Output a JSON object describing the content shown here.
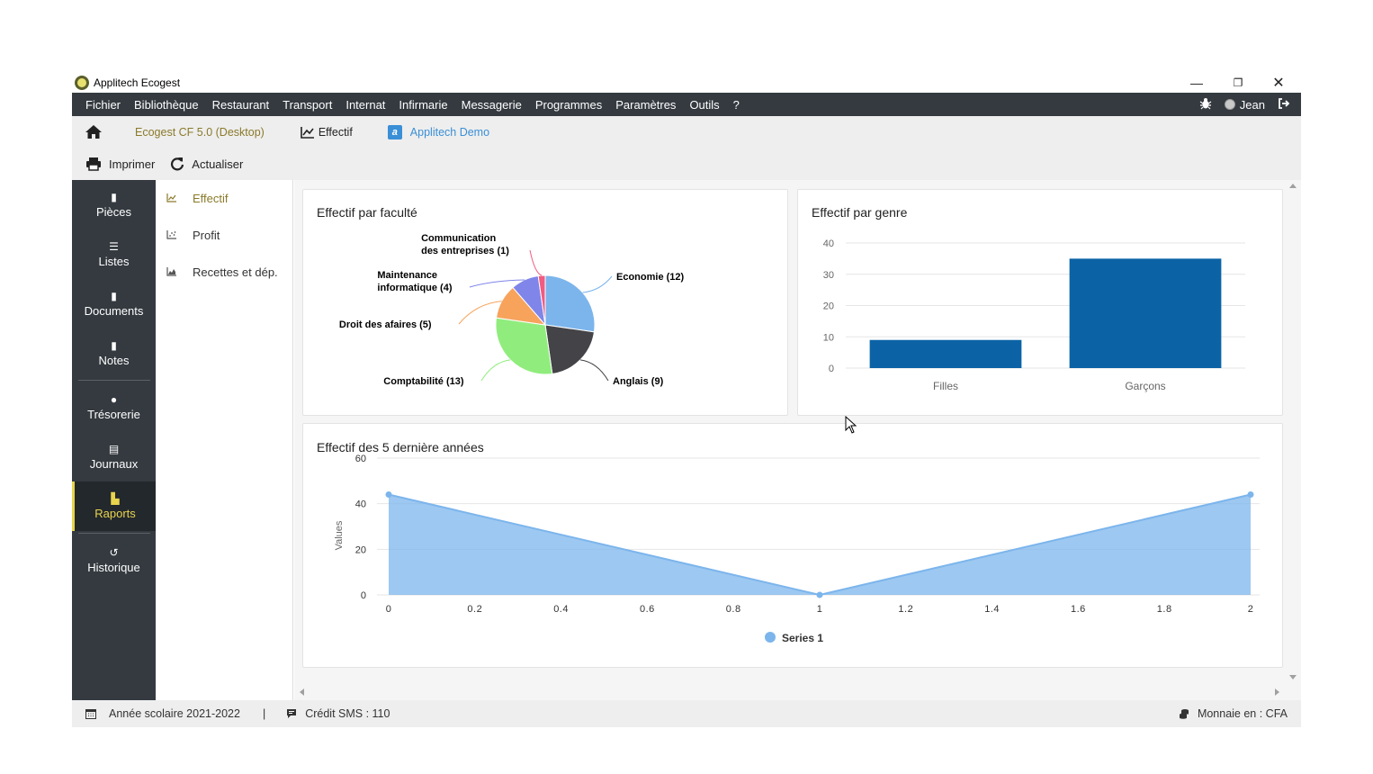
{
  "window": {
    "title": "Applitech Ecogest",
    "minimize_icon": "minimize-icon",
    "maximize_icon": "restore-icon",
    "close_icon": "close-icon"
  },
  "menubar": {
    "items": [
      "Fichier",
      "Bibliothèque",
      "Restaurant",
      "Transport",
      "Internat",
      "Infirmarie",
      "Messagerie",
      "Programmes",
      "Paramètres",
      "Outils",
      "?"
    ],
    "user_name": "Jean"
  },
  "toolbar1": {
    "home_icon": "home-icon",
    "app_version": "Ecogest CF 5.0 (Desktop)",
    "tab_effectif": "Effectif",
    "tab_demo": "Applitech Demo"
  },
  "toolbar2": {
    "print_label": "Imprimer",
    "refresh_label": "Actualiser"
  },
  "sidebar": {
    "items": [
      {
        "label": "Pièces",
        "icon": "file-icon"
      },
      {
        "label": "Listes",
        "icon": "list-icon"
      },
      {
        "label": "Documents",
        "icon": "document-icon"
      },
      {
        "label": "Notes",
        "icon": "notes-icon"
      },
      {
        "label": "Trésorerie",
        "icon": "piggy-bank-icon"
      },
      {
        "label": "Journaux",
        "icon": "journal-icon"
      },
      {
        "label": "Raports",
        "icon": "report-icon"
      },
      {
        "label": "Historique",
        "icon": "history-icon"
      }
    ]
  },
  "subnav": {
    "items": [
      "Effectif",
      "Profit",
      "Recettes et dép."
    ]
  },
  "cards": {
    "faculty_title": "Effectif par faculté",
    "gender_title": "Effectif par genre",
    "years_title": "Effectif des 5 dernière années"
  },
  "chart_data": [
    {
      "type": "pie",
      "title": "Effectif par faculté",
      "slices": [
        {
          "label": "Economie (12)",
          "value": 12,
          "color": "#7cb5ec"
        },
        {
          "label": "Anglais (9)",
          "value": 9,
          "color": "#434348"
        },
        {
          "label": "Comptabilité (13)",
          "value": 13,
          "color": "#90ed7d"
        },
        {
          "label": "Droit des afaires (5)",
          "value": 5,
          "color": "#f7a35c"
        },
        {
          "label": "Maintenance informatique (4)",
          "value": 4,
          "color": "#8085e9"
        },
        {
          "label": "Communication des entreprises (1)",
          "value": 1,
          "color": "#f15c80"
        }
      ]
    },
    {
      "type": "bar",
      "title": "Effectif par genre",
      "categories": [
        "Filles",
        "Garçons"
      ],
      "values": [
        9,
        35
      ],
      "ylim": [
        0,
        40
      ],
      "yticks": [
        0,
        10,
        20,
        30,
        40
      ],
      "color": "#0b63a5"
    },
    {
      "type": "area",
      "title": "Effectif des 5 dernière années",
      "x": [
        0,
        1,
        2
      ],
      "series": [
        {
          "name": "Series 1",
          "values": [
            44,
            0,
            44
          ],
          "color": "#7cb5ec"
        }
      ],
      "xlim": [
        0,
        2
      ],
      "xticks": [
        "0",
        "0.2",
        "0.4",
        "0.6",
        "0.8",
        "1",
        "1.2",
        "1.4",
        "1.6",
        "1.8",
        "2"
      ],
      "ylim": [
        0,
        60
      ],
      "yticks": [
        0,
        20,
        40,
        60
      ],
      "ylabel": "Values",
      "legend": "bottom-center"
    }
  ],
  "statusbar": {
    "school_year": "Année scolaire 2021-2022",
    "separator": "|",
    "sms_credit": "Crédit SMS : 110",
    "currency": "Monnaie en : CFA"
  }
}
